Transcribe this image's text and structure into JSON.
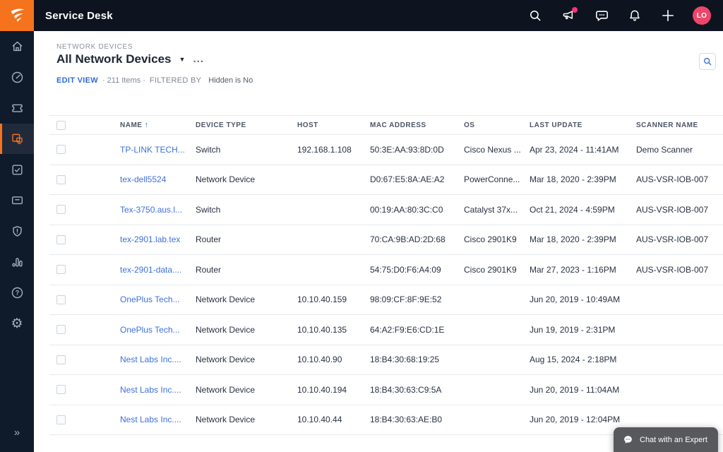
{
  "topbar": {
    "app_title": "Service Desk",
    "avatar_initials": "LO",
    "icons": [
      "search",
      "announcements",
      "chat",
      "notifications",
      "create",
      "avatar"
    ]
  },
  "sidebar": {
    "icons": [
      "home",
      "dashboard",
      "tickets",
      "devices",
      "tasks",
      "cards",
      "risk",
      "reports",
      "help",
      "setup",
      "expand"
    ],
    "active": "devices",
    "expand_glyph": "»"
  },
  "page": {
    "breadcrumb": "NETWORK DEVICES",
    "title": "All Network Devices",
    "title_caret": "▼",
    "more_glyph": "...",
    "edit_view_label": "EDIT VIEW",
    "items_count": "· 211 Items ·",
    "filtered_by_label": "FILTERED BY",
    "filter_value": "Hidden is No"
  },
  "table": {
    "columns": [
      "NAME",
      "DEVICE TYPE",
      "HOST",
      "MAC ADDRESS",
      "OS",
      "LAST UPDATE",
      "SCANNER NAME"
    ],
    "sort_column": "NAME",
    "sort_arrow": "↑",
    "rows": [
      {
        "name": "TP-LINK TECH...",
        "type": "Switch",
        "host": "192.168.1.108",
        "mac": "50:3E:AA:93:8D:0D",
        "os": "Cisco Nexus ...",
        "last_update": "Apr 23, 2024 - 11:41AM",
        "scanner": "Demo Scanner"
      },
      {
        "name": "tex-dell5524",
        "type": "Network Device",
        "host": "",
        "mac": "D0:67:E5:8A:AE:A2",
        "os": "PowerConne...",
        "last_update": "Mar 18, 2020 - 2:39PM",
        "scanner": "AUS-VSR-IOB-007"
      },
      {
        "name": "Tex-3750.aus.l...",
        "type": "Switch",
        "host": "",
        "mac": "00:19:AA:80:3C:C0",
        "os": "Catalyst 37x...",
        "last_update": "Oct 21, 2024 - 4:59PM",
        "scanner": "AUS-VSR-IOB-007"
      },
      {
        "name": "tex-2901.lab.tex",
        "type": "Router",
        "host": "",
        "mac": "70:CA:9B:AD:2D:68",
        "os": "Cisco 2901K9",
        "last_update": "Mar 18, 2020 - 2:39PM",
        "scanner": "AUS-VSR-IOB-007"
      },
      {
        "name": "tex-2901-data....",
        "type": "Router",
        "host": "",
        "mac": "54:75:D0:F6:A4:09",
        "os": "Cisco 2901K9",
        "last_update": "Mar 27, 2023 - 1:16PM",
        "scanner": "AUS-VSR-IOB-007"
      },
      {
        "name": "OnePlus Tech...",
        "type": "Network Device",
        "host": "10.10.40.159",
        "mac": "98:09:CF:8F:9E:52",
        "os": "",
        "last_update": "Jun 20, 2019 - 10:49AM",
        "scanner": ""
      },
      {
        "name": "OnePlus Tech...",
        "type": "Network Device",
        "host": "10.10.40.135",
        "mac": "64:A2:F9:E6:CD:1E",
        "os": "",
        "last_update": "Jun 19, 2019 - 2:31PM",
        "scanner": ""
      },
      {
        "name": "Nest Labs Inc....",
        "type": "Network Device",
        "host": "10.10.40.90",
        "mac": "18:B4:30:68:19:25",
        "os": "",
        "last_update": "Aug 15, 2024 - 2:18PM",
        "scanner": ""
      },
      {
        "name": "Nest Labs Inc....",
        "type": "Network Device",
        "host": "10.10.40.194",
        "mac": "18:B4:30:63:C9:5A",
        "os": "",
        "last_update": "Jun 20, 2019 - 11:04AM",
        "scanner": ""
      },
      {
        "name": "Nest Labs Inc....",
        "type": "Network Device",
        "host": "10.10.40.44",
        "mac": "18:B4:30:63:AE:B0",
        "os": "",
        "last_update": "Jun 20, 2019 - 12:04PM",
        "scanner": ""
      }
    ]
  },
  "chat": {
    "label": "Chat with an Expert"
  },
  "colors": {
    "brand_orange": "#f4731c",
    "topbar_bg": "#0e141f",
    "sidebar_bg": "#0f1a2a",
    "link_blue": "#3e70d8",
    "avatar_pink": "#ee4668",
    "notification_dot": "#f5347a",
    "chat_widget_bg": "#58595c"
  }
}
